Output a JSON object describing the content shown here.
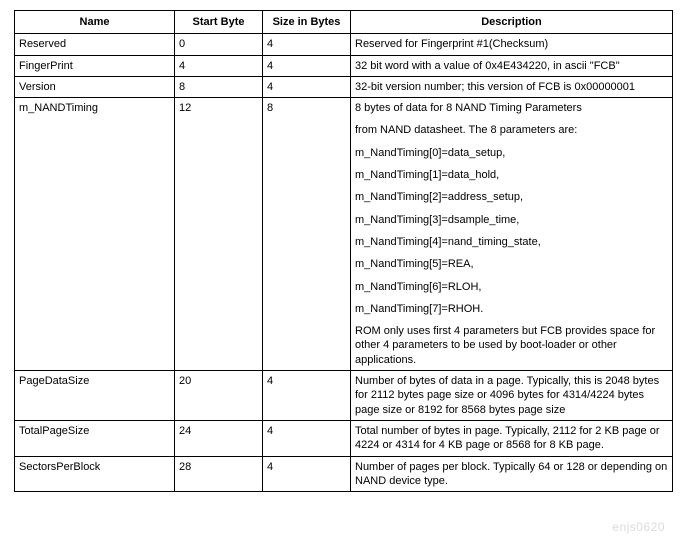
{
  "columns": {
    "name": "Name",
    "start": "Start Byte",
    "size": "Size in Bytes",
    "desc": "Description"
  },
  "rows": [
    {
      "name": "Reserved",
      "start": "0",
      "size": "4",
      "desc_lines": [
        "Reserved for Fingerprint #1(Checksum)"
      ],
      "tight": true
    },
    {
      "name": "FingerPrint",
      "start": "4",
      "size": "4",
      "desc_lines": [
        "32 bit word with a value of 0x4E434220, in ascii \"FCB\""
      ],
      "tight": true
    },
    {
      "name": "Version",
      "start": "8",
      "size": "4",
      "desc_lines": [
        "32-bit version number; this version of FCB is 0x00000001"
      ],
      "tight": true
    },
    {
      "name": "m_NANDTiming",
      "start": "12",
      "size": "8",
      "desc_lines": [
        "8 bytes of data for 8 NAND Timing Parameters",
        "from NAND datasheet. The 8 parameters are:",
        "m_NandTiming[0]=data_setup,",
        "m_NandTiming[1]=data_hold,",
        "m_NandTiming[2]=address_setup,",
        "m_NandTiming[3]=dsample_time,",
        "m_NandTiming[4]=nand_timing_state,",
        "m_NandTiming[5]=REA,",
        "m_NandTiming[6]=RLOH,",
        "m_NandTiming[7]=RHOH.",
        "ROM only uses first 4 parameters but FCB provides space for other 4 parameters to be used by boot-loader or other applications."
      ],
      "tight": false
    },
    {
      "name": "PageDataSize",
      "start": "20",
      "size": "4",
      "desc_lines": [
        "Number of bytes of data in a page. Typically, this is 2048 bytes for 2112 bytes page size or 4096 bytes for 4314/4224 bytes page size or 8192 for 8568 bytes page size"
      ],
      "tight": true
    },
    {
      "name": "TotalPageSize",
      "start": "24",
      "size": "4",
      "desc_lines": [
        "Total number of bytes in page. Typically, 2112 for 2 KB page or 4224 or 4314 for 4 KB page or 8568 for 8 KB page."
      ],
      "tight": true
    },
    {
      "name": "SectorsPerBlock",
      "start": "28",
      "size": "4",
      "desc_lines": [
        "Number of pages per block. Typically 64 or 128 or depending on NAND device type."
      ],
      "tight": true
    }
  ],
  "watermark": "enjs0620"
}
